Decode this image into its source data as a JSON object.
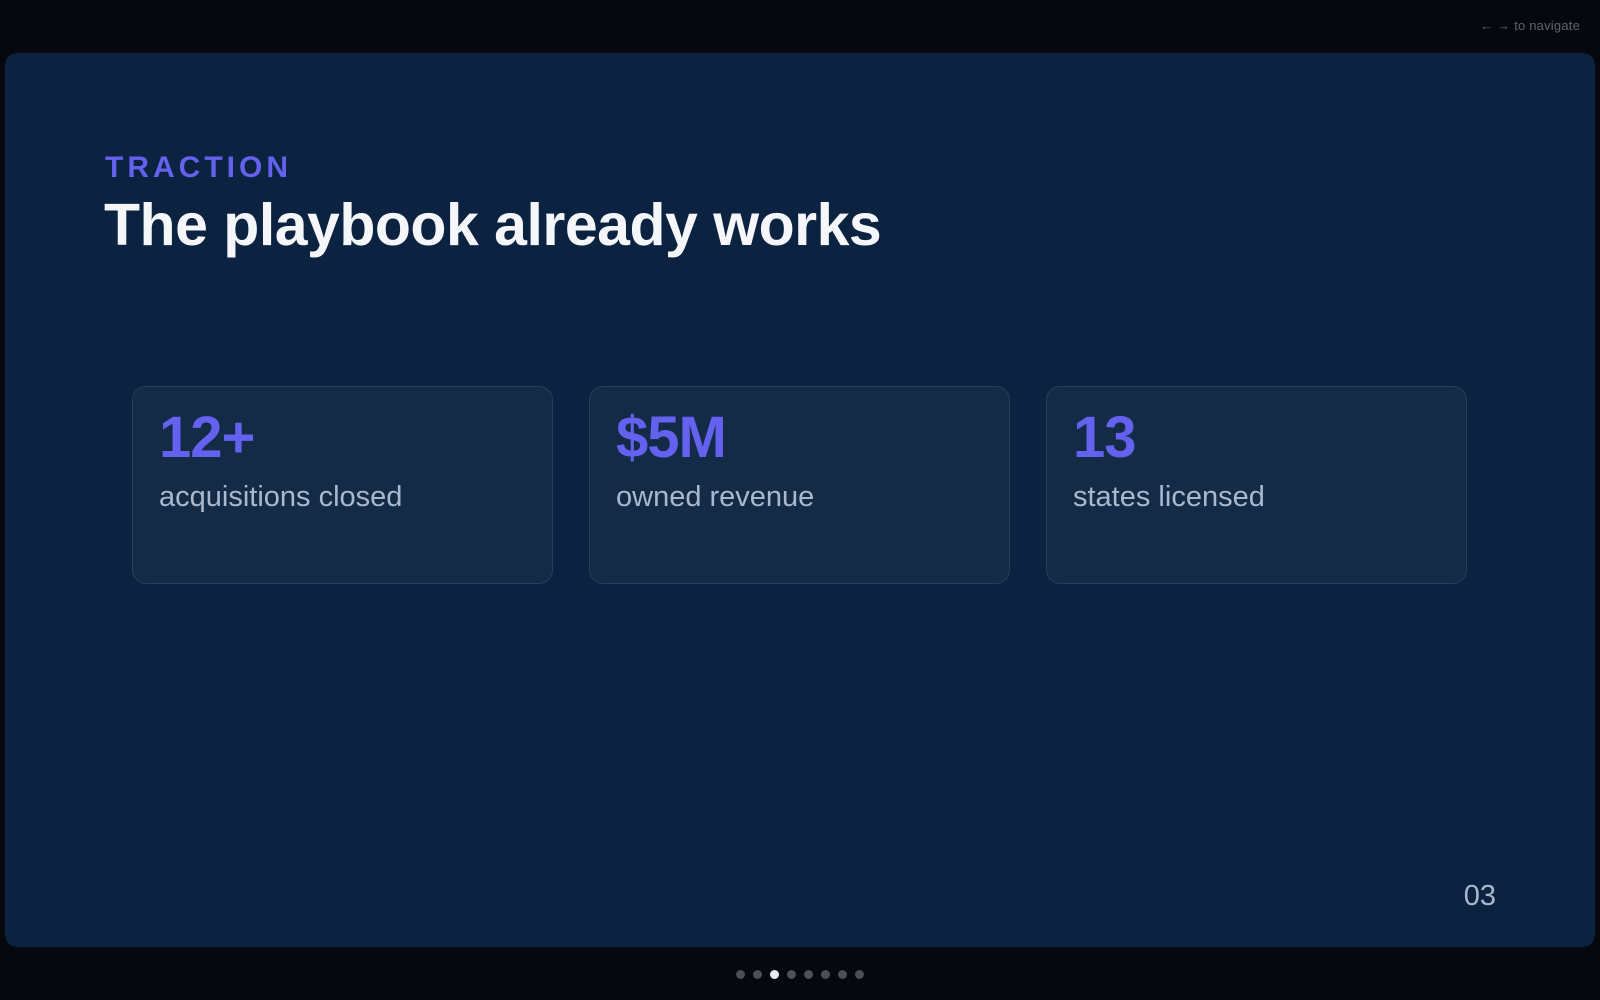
{
  "nav_hint": "← → to navigate",
  "slide": {
    "eyebrow": "TRACTION",
    "title": "The playbook already works",
    "page_number": "03",
    "stats": [
      {
        "value": "12+",
        "label": "acquisitions closed"
      },
      {
        "value": "$5M",
        "label": "owned revenue"
      },
      {
        "value": "13",
        "label": "states licensed"
      }
    ]
  },
  "pagination": {
    "total": 8,
    "current": 3
  },
  "colors": {
    "accent": "#6361ee",
    "slide_background": "#0b2240",
    "card_background": "#142b47",
    "page_background": "#06080d"
  }
}
